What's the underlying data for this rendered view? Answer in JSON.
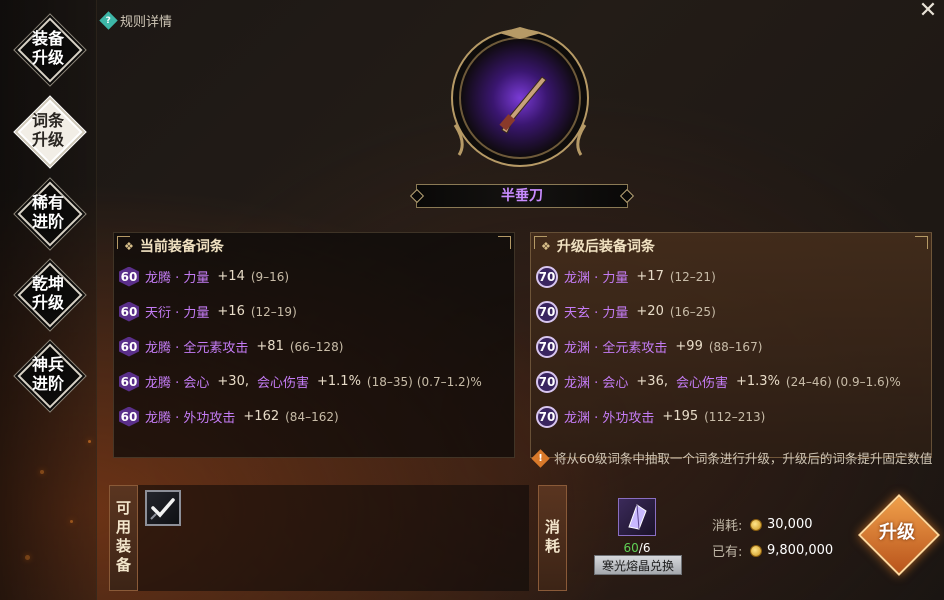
{
  "sidebar": {
    "items": [
      {
        "label": "装备\n升级",
        "active": false
      },
      {
        "label": "词条\n升级",
        "active": true
      },
      {
        "label": "稀有\n进阶",
        "active": false
      },
      {
        "label": "乾坤\n升级",
        "active": false
      },
      {
        "label": "神兵\n进阶",
        "active": false
      }
    ]
  },
  "header": {
    "rules_label": "规则详情",
    "rules_icon": "question-icon",
    "close_icon": "close-icon",
    "close_glyph": "✕"
  },
  "item": {
    "name": "半垂刀",
    "name_color": "#c98cff"
  },
  "current": {
    "title": "当前装备词条",
    "rows": [
      {
        "level": "60",
        "name": "龙腾 · 力量",
        "value": "+14",
        "range": "(9–16)",
        "crit": "",
        "range2": ""
      },
      {
        "level": "60",
        "name": "天衍 · 力量",
        "value": "+16",
        "range": "(12–19)",
        "crit": "",
        "range2": ""
      },
      {
        "level": "60",
        "name": "龙腾 · 全元素攻击",
        "value": "+81",
        "range": "(66–128)",
        "crit": "",
        "range2": ""
      },
      {
        "level": "60",
        "name": "龙腾 · 会心",
        "value": "+30,",
        "crit": "会心伤害",
        "crit_value": "+1.1%",
        "range": "(18–35)",
        "range2": "(0.7–1.2)%"
      },
      {
        "level": "60",
        "name": "龙腾 · 外功攻击",
        "value": "+162",
        "range": "(84–162)",
        "crit": "",
        "range2": ""
      }
    ]
  },
  "upgraded": {
    "title": "升级后装备词条",
    "rows": [
      {
        "level": "70",
        "name": "龙渊 · 力量",
        "value": "+17",
        "range": "(12–21)",
        "crit": "",
        "range2": ""
      },
      {
        "level": "70",
        "name": "天玄 · 力量",
        "value": "+20",
        "range": "(16–25)",
        "crit": "",
        "range2": ""
      },
      {
        "level": "70",
        "name": "龙渊 · 全元素攻击",
        "value": "+99",
        "range": "(88–167)",
        "crit": "",
        "range2": ""
      },
      {
        "level": "70",
        "name": "龙渊 · 会心",
        "value": "+36,",
        "crit": "会心伤害",
        "crit_value": "+1.3%",
        "range": "(24–46)",
        "range2": "(0.9–1.6)%"
      },
      {
        "level": "70",
        "name": "龙渊 · 外功攻击",
        "value": "+195",
        "range": "(112–213)",
        "crit": "",
        "range2": ""
      }
    ]
  },
  "note": {
    "text": "将从60级词条中抽取一个词条进行升级，升级后的词条提升固定数值",
    "icon": "warning-icon",
    "glyph": "!"
  },
  "available": {
    "label": "可用装备",
    "check_glyph": "✓"
  },
  "consume": {
    "label": "消耗",
    "material_count_have": "60",
    "material_count_need": "/6",
    "exchange_label": "寒光熔晶兑换",
    "cost_label": "消耗:",
    "cost_value": "30,000",
    "owned_label": "已有:",
    "owned_value": "9,800,000"
  },
  "upgrade_button": {
    "label": "升级"
  },
  "colors": {
    "accent_purple": "#c47cf5",
    "gold": "#d9c08a",
    "upgrade_orange": "#e0843a"
  }
}
